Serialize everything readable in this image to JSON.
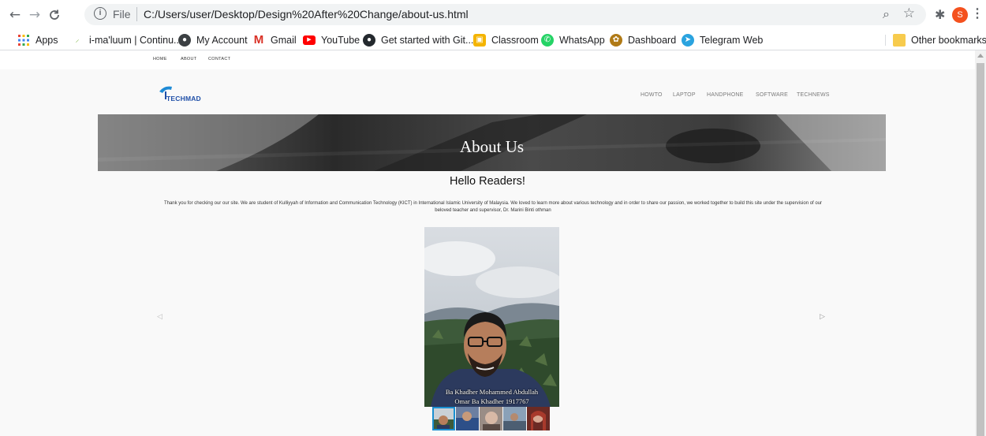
{
  "browser": {
    "file_label": "File",
    "url": "C:/Users/user/Desktop/Design%20After%20Change/about-us.html",
    "profile_initial": "S",
    "nav_icons": [
      "back-arrow-icon",
      "forward-arrow-icon",
      "reload-icon"
    ]
  },
  "bookmarks": {
    "items": [
      {
        "label": "Apps",
        "icon": "apps-grid-icon",
        "color": "#4285f4"
      },
      {
        "label": "i-ma'luum | Continu...",
        "icon": "imaluum-icon",
        "color": "#7cb342"
      },
      {
        "label": "My Account",
        "icon": "account-icon",
        "color": "#3c4043"
      },
      {
        "label": "Gmail",
        "icon": "gmail-icon",
        "color": "#d93025"
      },
      {
        "label": "YouTube",
        "icon": "youtube-icon",
        "color": "#ff0000"
      },
      {
        "label": "Get started with Git...",
        "icon": "github-icon",
        "color": "#24292e"
      },
      {
        "label": "Classroom",
        "icon": "classroom-icon",
        "color": "#f4b400"
      },
      {
        "label": "WhatsApp",
        "icon": "whatsapp-icon",
        "color": "#25d366"
      },
      {
        "label": "Dashboard",
        "icon": "dashboard-icon",
        "color": "#b07a16"
      },
      {
        "label": "Telegram Web",
        "icon": "telegram-icon",
        "color": "#2aa3df"
      }
    ],
    "other": "Other bookmarks"
  },
  "site": {
    "topbar": [
      "HOME",
      "ABOUT",
      "CONTACT"
    ],
    "logo_text": "TECHMAD",
    "mainnav": [
      "HOWTO",
      "LAPTOP",
      "HANDPHONE",
      "SOFTWARE",
      "TECHNEWS"
    ],
    "hero_title": "About Us",
    "greeting": "Hello Readers!",
    "intro": "Thank you for checking our our site. We are student of Kulliyyah of Information and Communication Technology (KICT) in International Islamic University of Malaysia. We loved to learn more about various technology and in order to share our passion, we worked together to build this site under the supervision of our beloved teacher and supervisor, Dr. Marini Binti othman",
    "caption_line1": "Ba Khadher Mohammed Abdullah",
    "caption_line2": "Omar Ba Khadher 1917767",
    "prev_arrow": "◁",
    "next_arrow": "▷",
    "active_slide": 1,
    "slide_count": 5
  }
}
